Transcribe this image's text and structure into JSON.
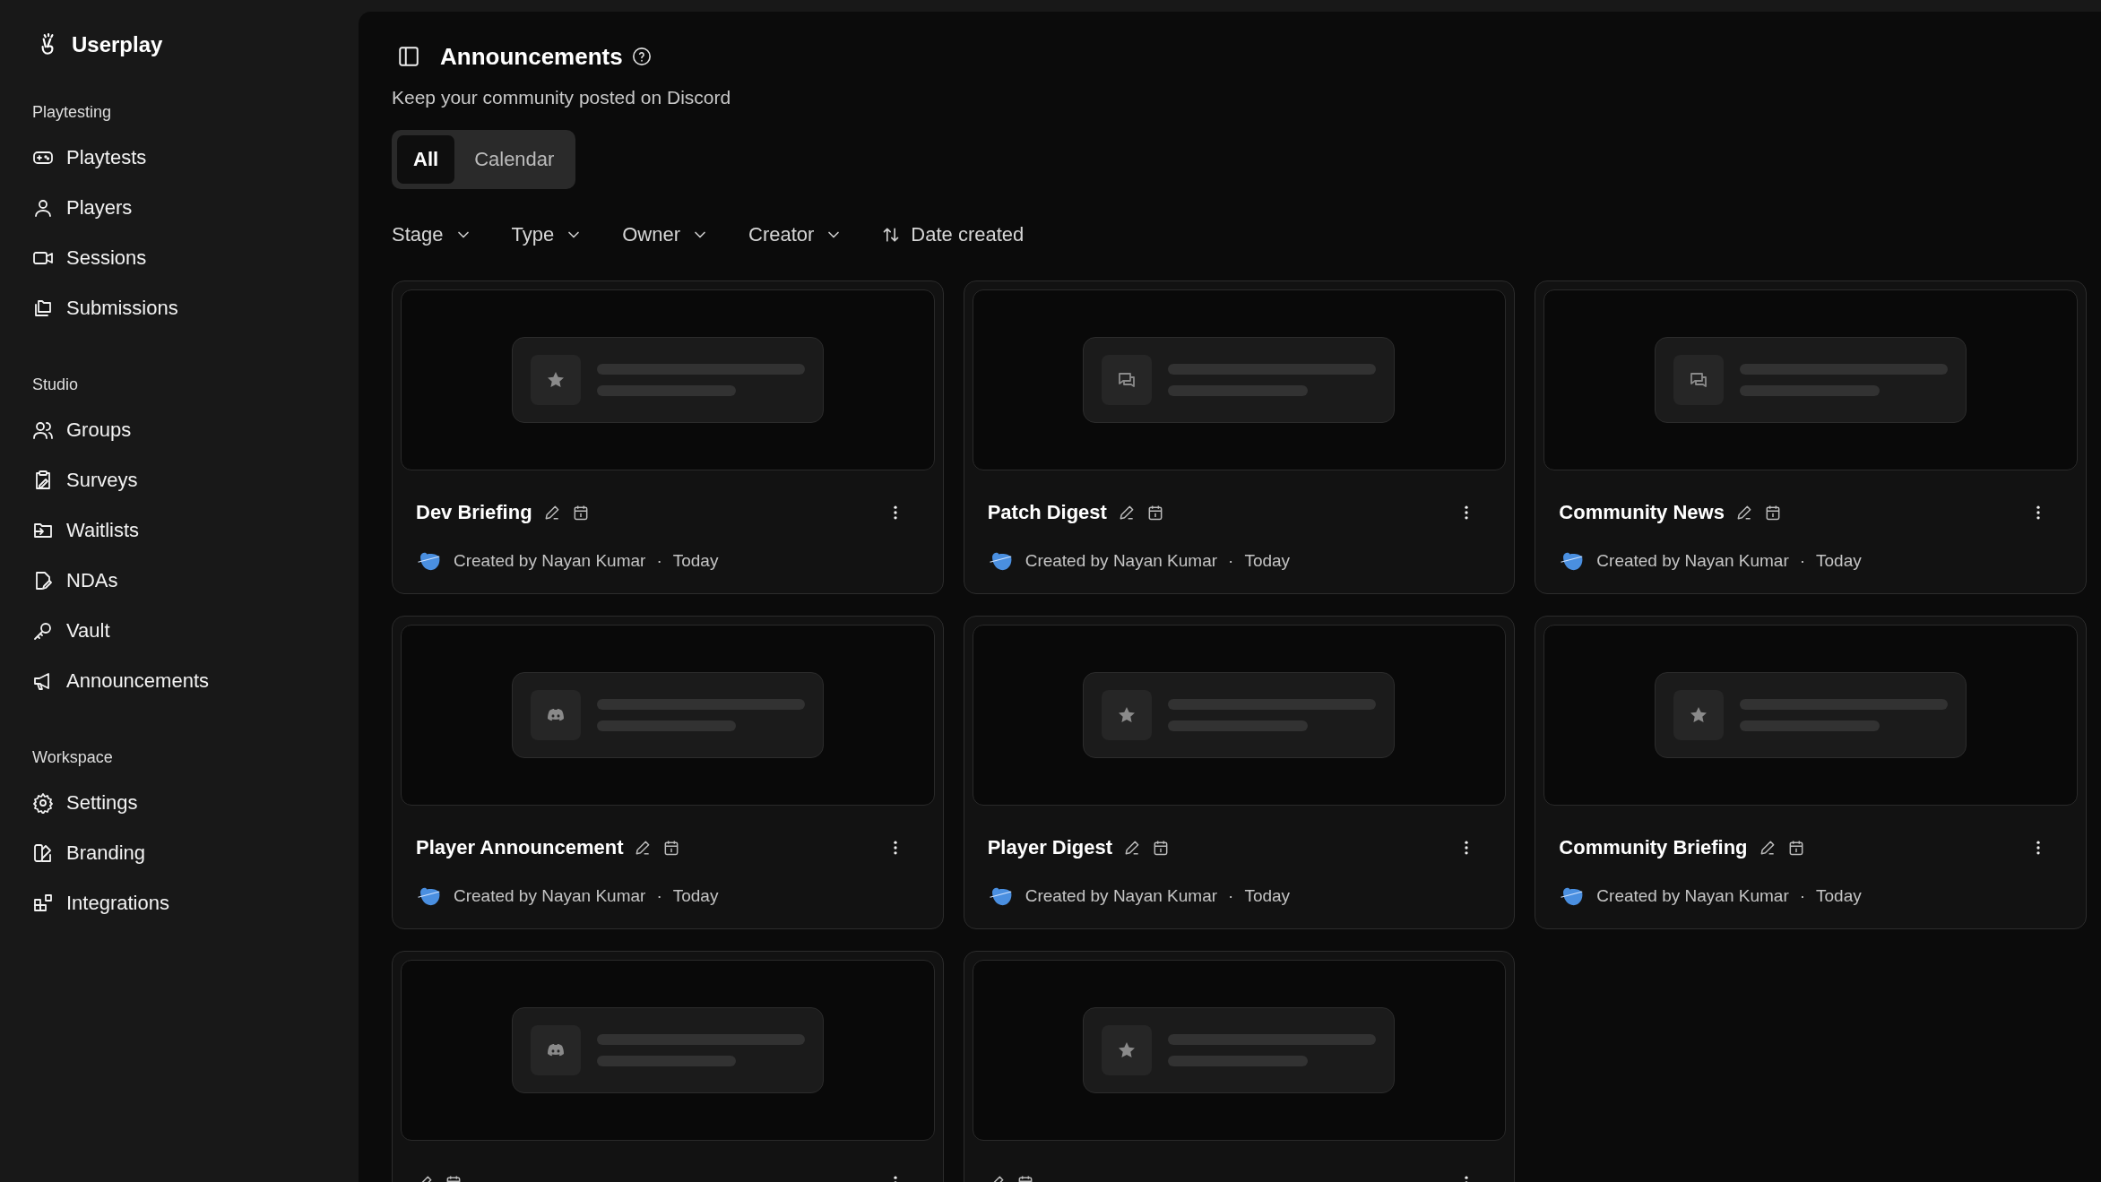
{
  "sidebar": {
    "brand": "Userplay",
    "sections": [
      {
        "heading": "Playtesting",
        "items": [
          {
            "label": "Playtests"
          },
          {
            "label": "Players"
          },
          {
            "label": "Sessions"
          },
          {
            "label": "Submissions"
          }
        ]
      },
      {
        "heading": "Studio",
        "items": [
          {
            "label": "Groups"
          },
          {
            "label": "Surveys"
          },
          {
            "label": "Waitlists"
          },
          {
            "label": "NDAs"
          },
          {
            "label": "Vault"
          },
          {
            "label": "Announcements"
          }
        ]
      },
      {
        "heading": "Workspace",
        "items": [
          {
            "label": "Settings"
          },
          {
            "label": "Branding"
          },
          {
            "label": "Integrations"
          }
        ]
      }
    ]
  },
  "header": {
    "title": "Announcements",
    "subtitle": "Keep your community posted on Discord"
  },
  "tabs": [
    {
      "label": "All",
      "selected": true
    },
    {
      "label": "Calendar",
      "selected": false
    }
  ],
  "filters": [
    {
      "label": "Stage",
      "kind": "dropdown"
    },
    {
      "label": "Type",
      "kind": "dropdown"
    },
    {
      "label": "Owner",
      "kind": "dropdown"
    },
    {
      "label": "Creator",
      "kind": "dropdown"
    },
    {
      "label": "Date created",
      "kind": "sort"
    }
  ],
  "cards": [
    {
      "title": "Dev Briefing",
      "byline": "Created by Nayan Kumar",
      "separator": "·",
      "date": "Today",
      "preview": {
        "kind": "star"
      }
    },
    {
      "title": "Patch Digest",
      "byline": "Created by Nayan Kumar",
      "separator": "·",
      "date": "Today",
      "preview": {
        "kind": "chat"
      }
    },
    {
      "title": "Community News",
      "byline": "Created by Nayan Kumar",
      "separator": "·",
      "date": "Today",
      "preview": {
        "kind": "chat"
      }
    },
    {
      "title": "Player Announcement",
      "byline": "Created by Nayan Kumar",
      "separator": "·",
      "date": "Today",
      "preview": {
        "kind": "discord"
      }
    },
    {
      "title": "Player Digest",
      "byline": "Created by Nayan Kumar",
      "separator": "·",
      "date": "Today",
      "preview": {
        "kind": "star"
      }
    },
    {
      "title": "Community Briefing",
      "byline": "Created by Nayan Kumar",
      "separator": "·",
      "date": "Today",
      "preview": {
        "kind": "star"
      }
    },
    {
      "preview": {
        "kind": "discord"
      }
    },
    {
      "preview": {
        "kind": "star"
      }
    }
  ]
}
